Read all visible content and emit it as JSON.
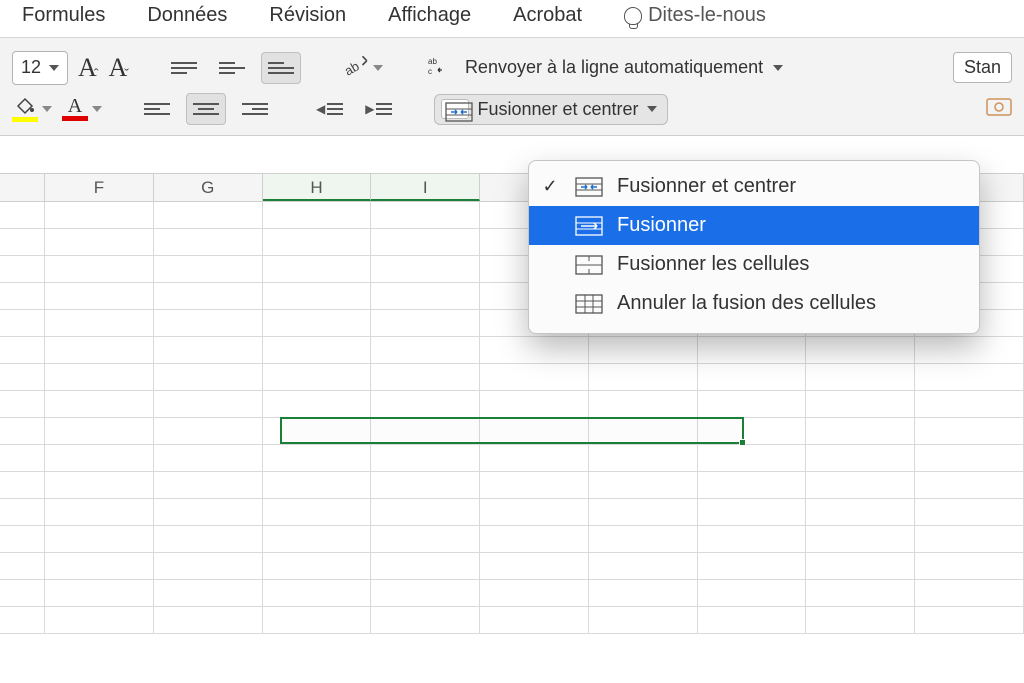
{
  "menu": {
    "tabs": [
      "Formules",
      "Données",
      "Révision",
      "Affichage",
      "Acrobat"
    ],
    "tell_me": "Dites-le-nous"
  },
  "ribbon": {
    "font_size": "12",
    "wrap_label": "Renvoyer à la ligne automatiquement",
    "merge_label": "Fusionner et centrer",
    "number_format": "Stan"
  },
  "columns": [
    "F",
    "G",
    "H",
    "I",
    "",
    "",
    "",
    "",
    ""
  ],
  "selected_columns": [
    "H",
    "I"
  ],
  "dropdown": {
    "items": [
      {
        "label": "Fusionner et centrer",
        "checked": true
      },
      {
        "label": "Fusionner",
        "checked": false,
        "highlighted": true
      },
      {
        "label": "Fusionner les cellules",
        "checked": false
      },
      {
        "label": "Annuler la fusion des cellules",
        "checked": false
      }
    ]
  },
  "colors": {
    "fill": "#ffff00",
    "font": "#e10000",
    "selection": "#1a7f37",
    "highlight": "#1a6fe8"
  }
}
